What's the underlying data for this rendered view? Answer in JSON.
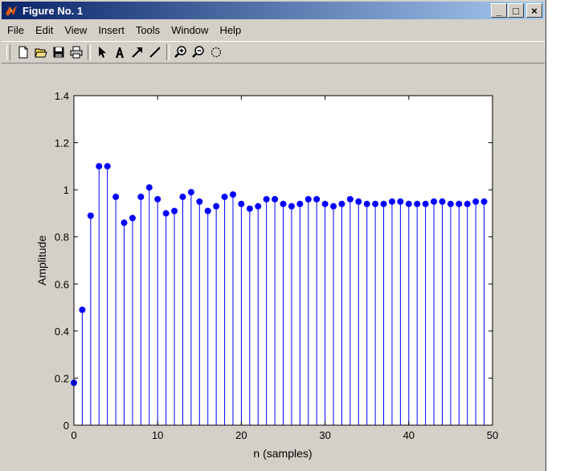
{
  "window": {
    "title": "Figure No. 1"
  },
  "window_controls": {
    "minimize": "_",
    "maximize": "□",
    "close": "×"
  },
  "menu": [
    "File",
    "Edit",
    "View",
    "Insert",
    "Tools",
    "Window",
    "Help"
  ],
  "toolbar": [
    "new-icon",
    "open-icon",
    "save-icon",
    "print-icon",
    "pointer-icon",
    "text-icon",
    "arrow-icon",
    "line-icon",
    "zoom-in-icon",
    "zoom-out-icon",
    "rotate-icon"
  ],
  "colors": {
    "stem": "#0000ff",
    "window_bg": "#d4d0c8",
    "title_bar": "#0a246a"
  },
  "chart_data": {
    "type": "scatter",
    "style": "stem",
    "xlabel": "n (samples)",
    "ylabel": "Amplitude",
    "xlim": [
      0,
      50
    ],
    "ylim": [
      0,
      1.4
    ],
    "xticks": [
      0,
      10,
      20,
      30,
      40,
      50
    ],
    "yticks": [
      0,
      0.2,
      0.4,
      0.6,
      0.8,
      1,
      1.2,
      1.4
    ],
    "x": [
      0,
      1,
      2,
      3,
      4,
      5,
      6,
      7,
      8,
      9,
      10,
      11,
      12,
      13,
      14,
      15,
      16,
      17,
      18,
      19,
      20,
      21,
      22,
      23,
      24,
      25,
      26,
      27,
      28,
      29,
      30,
      31,
      32,
      33,
      34,
      35,
      36,
      37,
      38,
      39,
      40,
      41,
      42,
      43,
      44,
      45,
      46,
      47,
      48,
      49
    ],
    "values": [
      0.18,
      0.49,
      0.89,
      1.1,
      1.1,
      0.97,
      0.86,
      0.88,
      0.97,
      1.01,
      0.96,
      0.9,
      0.91,
      0.97,
      0.99,
      0.95,
      0.91,
      0.93,
      0.97,
      0.98,
      0.94,
      0.92,
      0.93,
      0.96,
      0.96,
      0.94,
      0.93,
      0.94,
      0.96,
      0.96,
      0.94,
      0.93,
      0.94,
      0.96,
      0.95,
      0.94,
      0.94,
      0.94,
      0.95,
      0.95,
      0.94,
      0.94,
      0.94,
      0.95,
      0.95,
      0.94,
      0.94,
      0.94,
      0.95,
      0.95
    ]
  }
}
